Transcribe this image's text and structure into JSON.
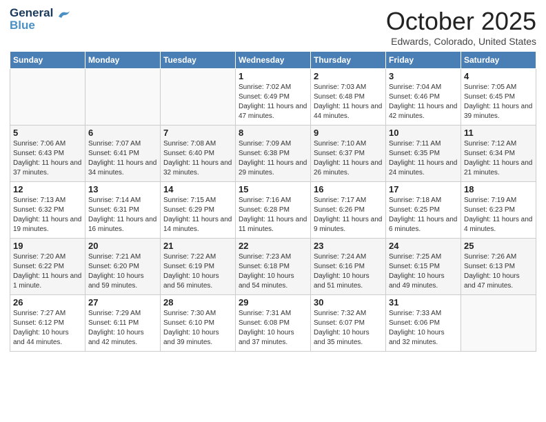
{
  "logo": {
    "line1": "General",
    "line2": "Blue"
  },
  "title": "October 2025",
  "location": "Edwards, Colorado, United States",
  "days_header": [
    "Sunday",
    "Monday",
    "Tuesday",
    "Wednesday",
    "Thursday",
    "Friday",
    "Saturday"
  ],
  "weeks": [
    [
      {
        "num": "",
        "info": ""
      },
      {
        "num": "",
        "info": ""
      },
      {
        "num": "",
        "info": ""
      },
      {
        "num": "1",
        "info": "Sunrise: 7:02 AM\nSunset: 6:49 PM\nDaylight: 11 hours and 47 minutes."
      },
      {
        "num": "2",
        "info": "Sunrise: 7:03 AM\nSunset: 6:48 PM\nDaylight: 11 hours and 44 minutes."
      },
      {
        "num": "3",
        "info": "Sunrise: 7:04 AM\nSunset: 6:46 PM\nDaylight: 11 hours and 42 minutes."
      },
      {
        "num": "4",
        "info": "Sunrise: 7:05 AM\nSunset: 6:45 PM\nDaylight: 11 hours and 39 minutes."
      }
    ],
    [
      {
        "num": "5",
        "info": "Sunrise: 7:06 AM\nSunset: 6:43 PM\nDaylight: 11 hours and 37 minutes."
      },
      {
        "num": "6",
        "info": "Sunrise: 7:07 AM\nSunset: 6:41 PM\nDaylight: 11 hours and 34 minutes."
      },
      {
        "num": "7",
        "info": "Sunrise: 7:08 AM\nSunset: 6:40 PM\nDaylight: 11 hours and 32 minutes."
      },
      {
        "num": "8",
        "info": "Sunrise: 7:09 AM\nSunset: 6:38 PM\nDaylight: 11 hours and 29 minutes."
      },
      {
        "num": "9",
        "info": "Sunrise: 7:10 AM\nSunset: 6:37 PM\nDaylight: 11 hours and 26 minutes."
      },
      {
        "num": "10",
        "info": "Sunrise: 7:11 AM\nSunset: 6:35 PM\nDaylight: 11 hours and 24 minutes."
      },
      {
        "num": "11",
        "info": "Sunrise: 7:12 AM\nSunset: 6:34 PM\nDaylight: 11 hours and 21 minutes."
      }
    ],
    [
      {
        "num": "12",
        "info": "Sunrise: 7:13 AM\nSunset: 6:32 PM\nDaylight: 11 hours and 19 minutes."
      },
      {
        "num": "13",
        "info": "Sunrise: 7:14 AM\nSunset: 6:31 PM\nDaylight: 11 hours and 16 minutes."
      },
      {
        "num": "14",
        "info": "Sunrise: 7:15 AM\nSunset: 6:29 PM\nDaylight: 11 hours and 14 minutes."
      },
      {
        "num": "15",
        "info": "Sunrise: 7:16 AM\nSunset: 6:28 PM\nDaylight: 11 hours and 11 minutes."
      },
      {
        "num": "16",
        "info": "Sunrise: 7:17 AM\nSunset: 6:26 PM\nDaylight: 11 hours and 9 minutes."
      },
      {
        "num": "17",
        "info": "Sunrise: 7:18 AM\nSunset: 6:25 PM\nDaylight: 11 hours and 6 minutes."
      },
      {
        "num": "18",
        "info": "Sunrise: 7:19 AM\nSunset: 6:23 PM\nDaylight: 11 hours and 4 minutes."
      }
    ],
    [
      {
        "num": "19",
        "info": "Sunrise: 7:20 AM\nSunset: 6:22 PM\nDaylight: 11 hours and 1 minute."
      },
      {
        "num": "20",
        "info": "Sunrise: 7:21 AM\nSunset: 6:20 PM\nDaylight: 10 hours and 59 minutes."
      },
      {
        "num": "21",
        "info": "Sunrise: 7:22 AM\nSunset: 6:19 PM\nDaylight: 10 hours and 56 minutes."
      },
      {
        "num": "22",
        "info": "Sunrise: 7:23 AM\nSunset: 6:18 PM\nDaylight: 10 hours and 54 minutes."
      },
      {
        "num": "23",
        "info": "Sunrise: 7:24 AM\nSunset: 6:16 PM\nDaylight: 10 hours and 51 minutes."
      },
      {
        "num": "24",
        "info": "Sunrise: 7:25 AM\nSunset: 6:15 PM\nDaylight: 10 hours and 49 minutes."
      },
      {
        "num": "25",
        "info": "Sunrise: 7:26 AM\nSunset: 6:13 PM\nDaylight: 10 hours and 47 minutes."
      }
    ],
    [
      {
        "num": "26",
        "info": "Sunrise: 7:27 AM\nSunset: 6:12 PM\nDaylight: 10 hours and 44 minutes."
      },
      {
        "num": "27",
        "info": "Sunrise: 7:29 AM\nSunset: 6:11 PM\nDaylight: 10 hours and 42 minutes."
      },
      {
        "num": "28",
        "info": "Sunrise: 7:30 AM\nSunset: 6:10 PM\nDaylight: 10 hours and 39 minutes."
      },
      {
        "num": "29",
        "info": "Sunrise: 7:31 AM\nSunset: 6:08 PM\nDaylight: 10 hours and 37 minutes."
      },
      {
        "num": "30",
        "info": "Sunrise: 7:32 AM\nSunset: 6:07 PM\nDaylight: 10 hours and 35 minutes."
      },
      {
        "num": "31",
        "info": "Sunrise: 7:33 AM\nSunset: 6:06 PM\nDaylight: 10 hours and 32 minutes."
      },
      {
        "num": "",
        "info": ""
      }
    ]
  ]
}
